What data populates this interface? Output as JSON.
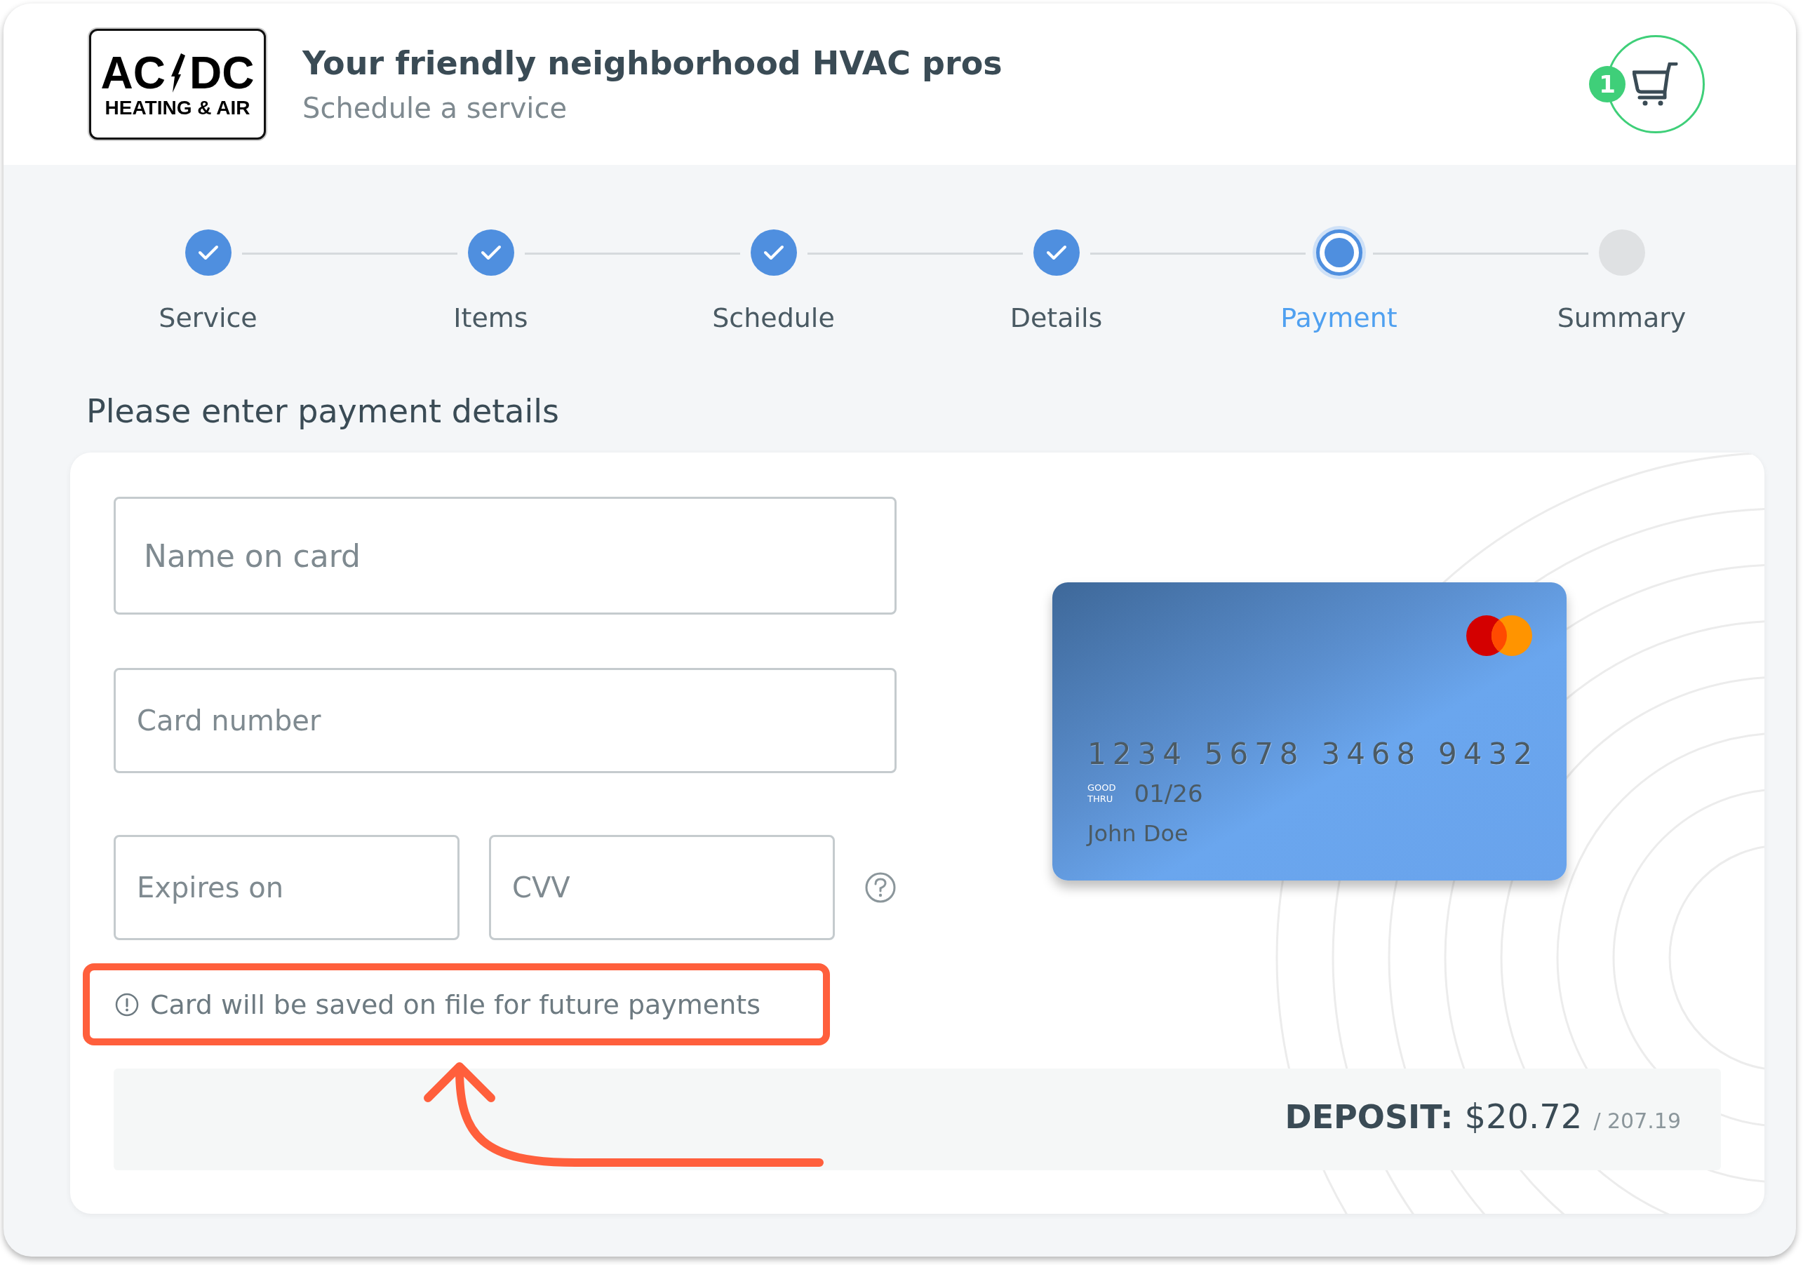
{
  "header": {
    "logo": {
      "top_left": "AC",
      "top_right": "DC",
      "bottom": "HEATING & AIR"
    },
    "title": "Your friendly neighborhood HVAC pros",
    "subtitle": "Schedule a service",
    "cart": {
      "count": "1"
    }
  },
  "steps": [
    {
      "label": "Service",
      "completed": true,
      "selected": false
    },
    {
      "label": "Items",
      "completed": true,
      "selected": false
    },
    {
      "label": "Schedule",
      "completed": true,
      "selected": false
    },
    {
      "label": "Details",
      "completed": true,
      "selected": false
    },
    {
      "label": "Payment",
      "completed": false,
      "selected": true
    },
    {
      "label": "Summary",
      "completed": false,
      "selected": false
    }
  ],
  "heading": "Please enter payment details",
  "form": {
    "name": {
      "placeholder": "Name on card"
    },
    "number": {
      "placeholder": "Card number"
    },
    "expiry": {
      "placeholder": "Expires on"
    },
    "cvv": {
      "placeholder": "CVV"
    },
    "note": "Card will be saved on file for future payments"
  },
  "card_preview": {
    "number_groups": [
      "1234",
      "5678",
      "3468",
      "9432"
    ],
    "good_thru": [
      "GOOD",
      "THRU"
    ],
    "expiry": "01/26",
    "holder": "John Doe"
  },
  "deposit": {
    "label": "DEPOSIT:",
    "amount": "$20.72",
    "total": "/ 207.19"
  }
}
